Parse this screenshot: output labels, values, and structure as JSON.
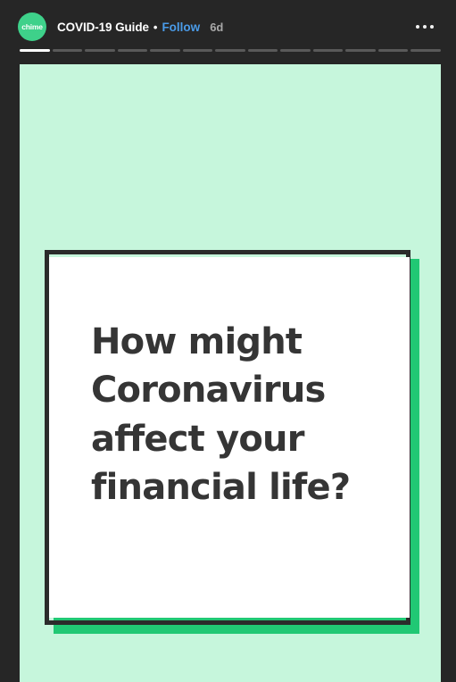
{
  "app": {
    "background_color": "#262626",
    "accent_follow_color": "#4A9BE8"
  },
  "header": {
    "avatar": {
      "icon": "chime-brand-avatar",
      "label": "chime",
      "background_color": "#3ED18A"
    },
    "account_name": "COVID-19 Guide",
    "separator": "•",
    "follow_label": "Follow",
    "timestamp": "6d",
    "more_options_icon": "ellipsis-horizontal-icon"
  },
  "progress": {
    "total_segments": 13,
    "active_index": 0,
    "active_color": "#FFFFFF",
    "inactive_color": "#595959"
  },
  "story": {
    "background_color": "#C6F6DC",
    "card": {
      "shadow_color": "#21C874",
      "frame_color": "#2B2B2B",
      "body_color": "#FFFFFF",
      "text_color": "#353535",
      "headline": "How might Coronavirus affect your financial life?"
    }
  }
}
